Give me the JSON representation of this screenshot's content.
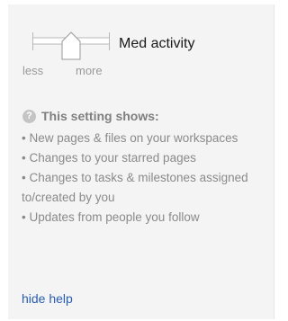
{
  "activity": {
    "level_label": "Med activity",
    "scale_min_label": "less",
    "scale_max_label": "more",
    "level_fraction": 0.5
  },
  "help": {
    "icon": "question-mark-icon",
    "title": "This setting shows:",
    "items": [
      "• New pages & files on your workspaces",
      "• Changes to your starred pages",
      "• Changes to tasks & milestones assigned to/created by you",
      "• Updates from people you follow"
    ],
    "hide_link": "hide help"
  },
  "colors": {
    "panel_background": "#f4f4f4",
    "link": "#2a5db0",
    "muted_text": "#8a8a8a"
  }
}
